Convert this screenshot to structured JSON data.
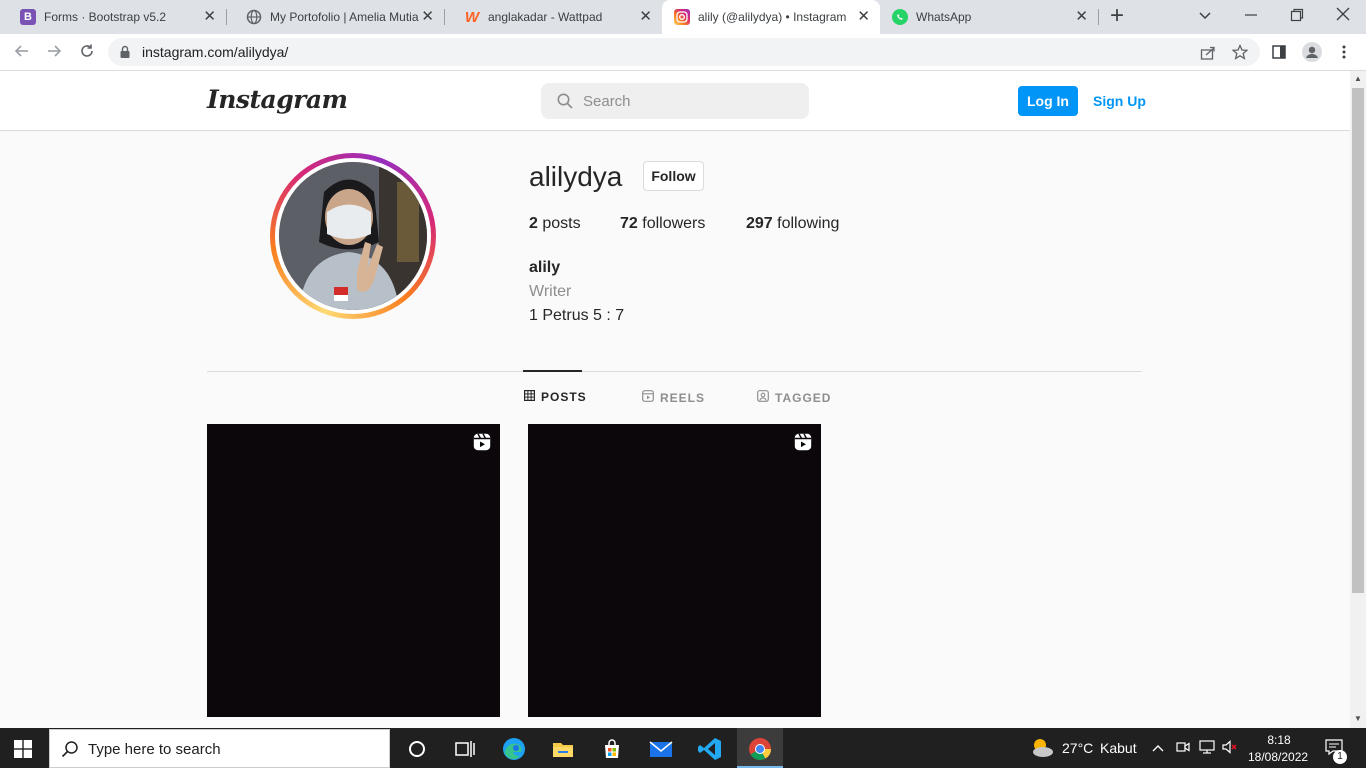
{
  "browser": {
    "tabs": [
      {
        "title": "Forms · Bootstrap v5.2",
        "icon": "bootstrap-icon",
        "close": "✕"
      },
      {
        "title": "My Portofolio | Amelia Mutia",
        "icon": "globe-icon",
        "close": "✕"
      },
      {
        "title": "anglakadar - Wattpad",
        "icon": "wattpad-icon",
        "close": "✕"
      },
      {
        "title": "alily (@alilydya) • Instagram p",
        "icon": "instagram-icon",
        "close": "✕"
      },
      {
        "title": "WhatsApp",
        "icon": "whatsapp-icon",
        "close": "✕"
      }
    ],
    "new_tab": "+",
    "url": "instagram.com/alilydya/"
  },
  "header": {
    "logo": "Instagram",
    "search_placeholder": "Search",
    "login_label": "Log In",
    "signup_label": "Sign Up"
  },
  "profile": {
    "username": "alilydya",
    "follow_label": "Follow",
    "posts_count": "2",
    "posts_label": "posts",
    "followers_count": "72",
    "followers_label": "followers",
    "following_count": "297",
    "following_label": "following",
    "full_name": "alily",
    "category": "Writer",
    "bio": "1 Petrus 5 : 7"
  },
  "tabs": {
    "posts": "POSTS",
    "reels": "REELS",
    "tagged": "TAGGED"
  },
  "posts": [
    {
      "type": "reel"
    },
    {
      "type": "reel"
    }
  ],
  "taskbar": {
    "search_placeholder": "Type here to search",
    "weather_temp": "27°C",
    "weather_text": "Kabut",
    "time": "8:18",
    "date": "18/08/2022",
    "notification_count": "1"
  },
  "colors": {
    "accent": "#0095f6",
    "text": "#262626",
    "muted": "#8e8e8e",
    "border": "#dbdbdb"
  }
}
